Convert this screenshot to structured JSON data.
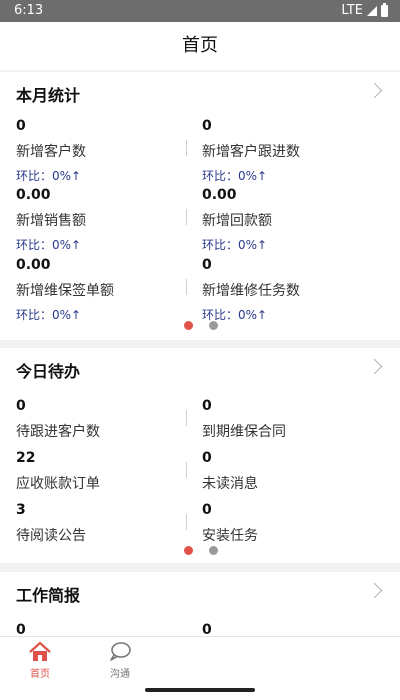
{
  "status_bar": {
    "time": "6:13",
    "network": "LTE"
  },
  "header": {
    "title": "首页"
  },
  "monthly": {
    "title": "本月统计",
    "items": [
      {
        "value": "0",
        "label": "新增客户数",
        "ratio": "环比：0%↑"
      },
      {
        "value": "0",
        "label": "新增客户跟进数",
        "ratio": "环比：0%↑"
      },
      {
        "value": "0.00",
        "label": "新增销售额",
        "ratio": "环比：0%↑"
      },
      {
        "value": "0.00",
        "label": "新增回款额",
        "ratio": "环比：0%↑"
      },
      {
        "value": "0.00",
        "label": "新增维保签单额",
        "ratio": "环比：0%↑"
      },
      {
        "value": "0",
        "label": "新增维修任务数",
        "ratio": "环比：0%↑"
      }
    ]
  },
  "todo": {
    "title": "今日待办",
    "items": [
      {
        "value": "0",
        "label": "待跟进客户数"
      },
      {
        "value": "0",
        "label": "到期维保合同"
      },
      {
        "value": "22",
        "label": "应收账款订单"
      },
      {
        "value": "0",
        "label": "未读消息"
      },
      {
        "value": "3",
        "label": "待阅读公告"
      },
      {
        "value": "0",
        "label": "安装任务"
      }
    ]
  },
  "report": {
    "title": "工作简报",
    "items": [
      {
        "value": "0"
      },
      {
        "value": "0"
      }
    ]
  },
  "tabbar": {
    "items": [
      {
        "label": "首页"
      },
      {
        "label": "沟通"
      }
    ]
  },
  "colors": {
    "accent": "#e0524a",
    "ratio_text": "#2a3a8c"
  }
}
